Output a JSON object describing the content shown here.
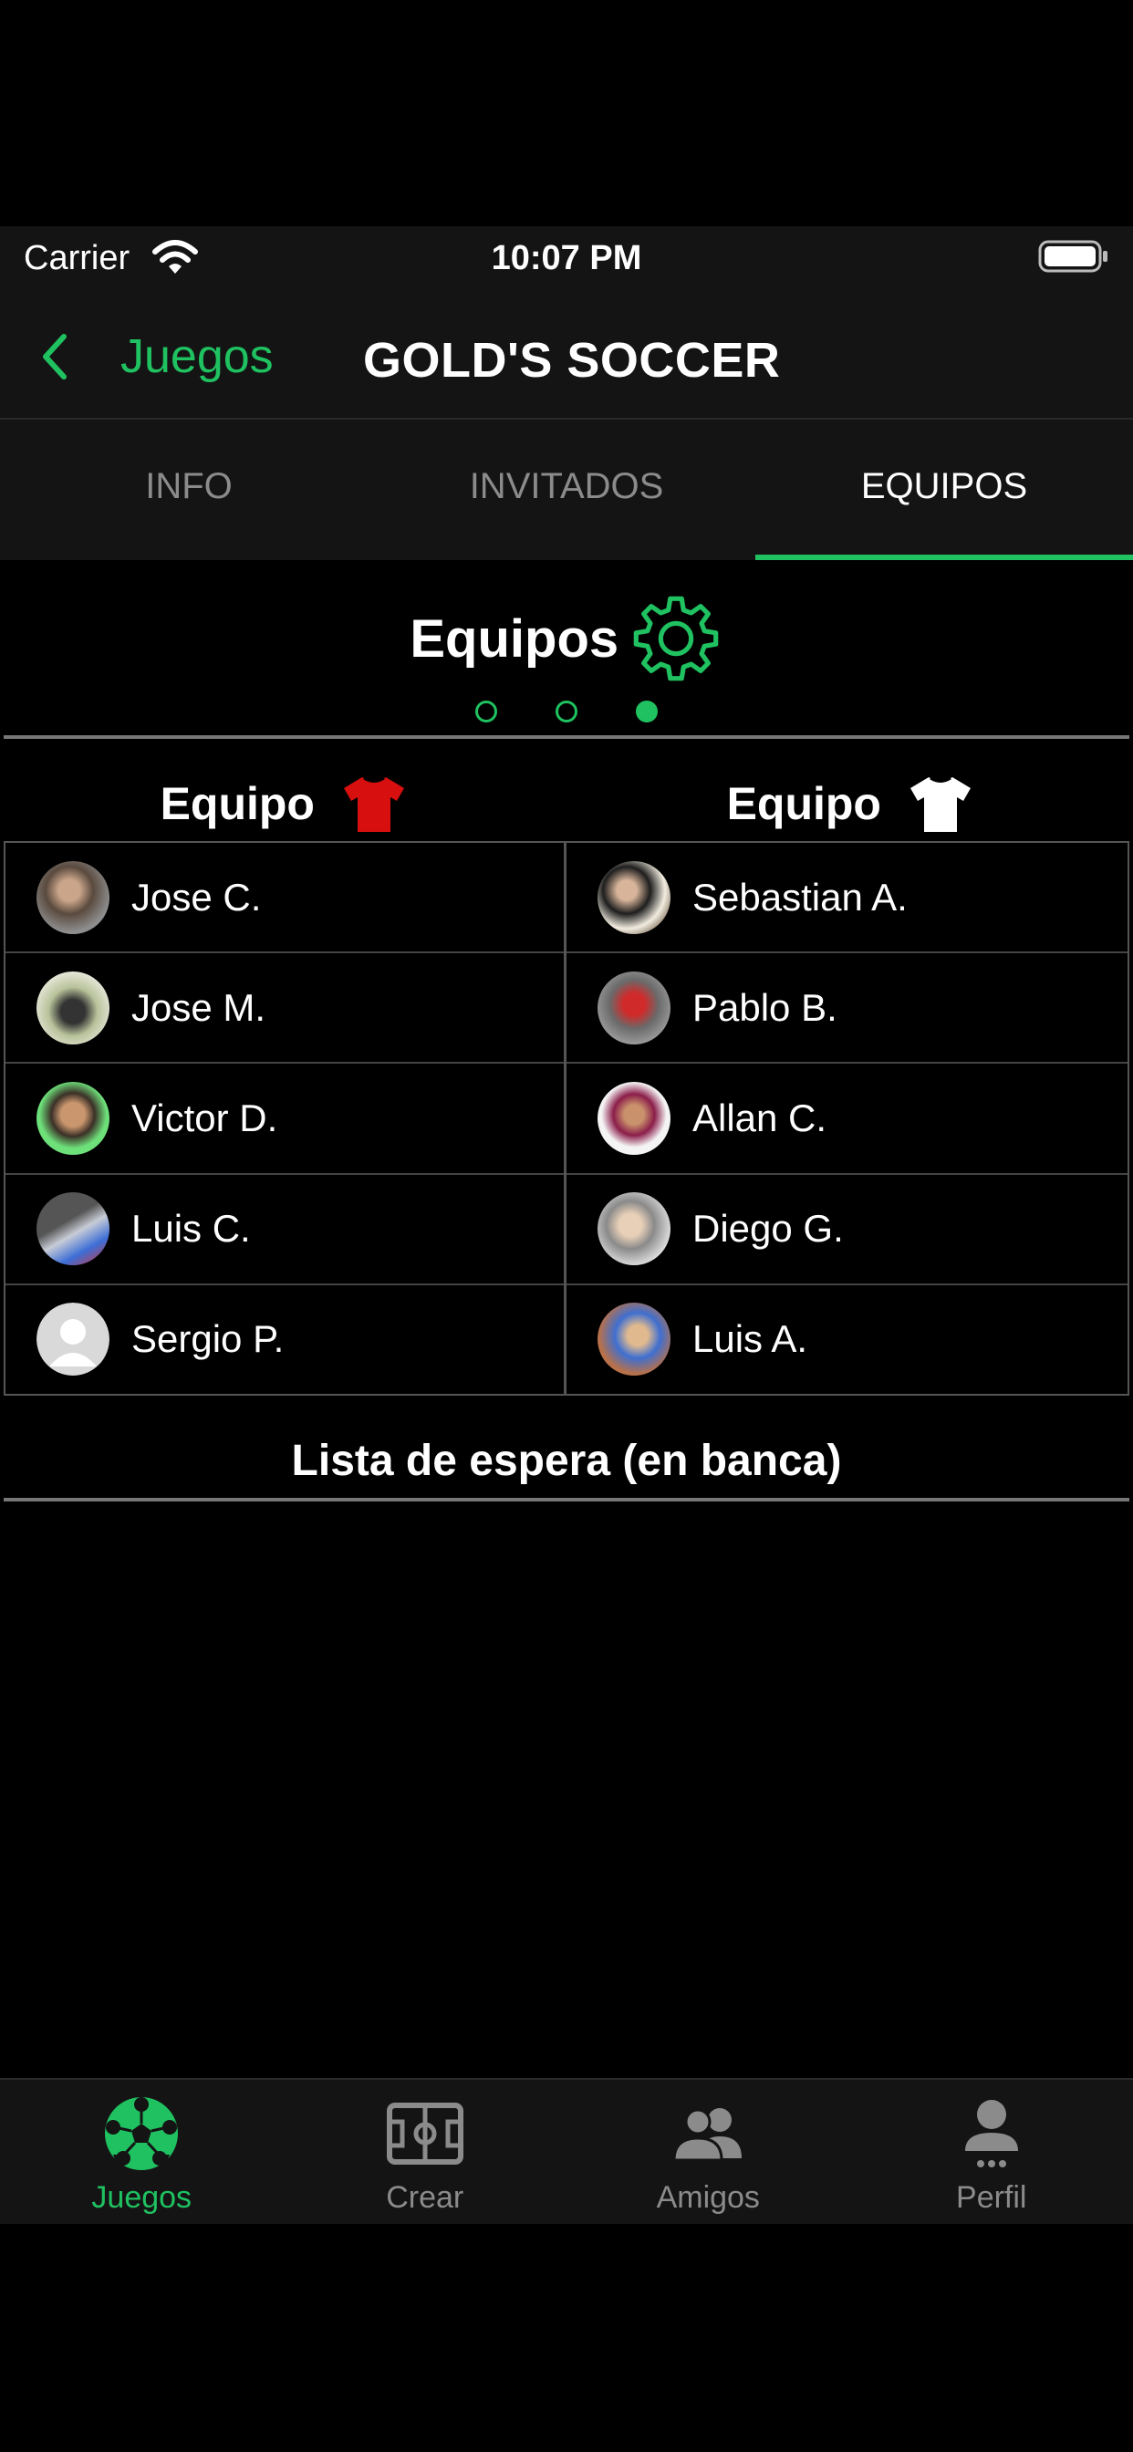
{
  "status_bar": {
    "carrier": "Carrier",
    "time": "10:07 PM"
  },
  "nav": {
    "back_label": "Juegos",
    "title": "GOLD'S SOCCER"
  },
  "tabs": [
    {
      "label": "INFO",
      "active": false
    },
    {
      "label": "INVITADOS",
      "active": false
    },
    {
      "label": "EQUIPOS",
      "active": true
    }
  ],
  "section": {
    "title": "Equipos",
    "page_indicator": {
      "count": 3,
      "current": 3
    }
  },
  "teams": {
    "left": {
      "label": "Equipo",
      "shirt_color": "#d80f0f",
      "players": [
        "Jose C.",
        "Jose M.",
        "Victor D.",
        "Luis C.",
        "Sergio P."
      ]
    },
    "right": {
      "label": "Equipo",
      "shirt_color": "#ffffff",
      "players": [
        "Sebastian A.",
        "Pablo B.",
        "Allan C.",
        "Diego G.",
        "Luis A."
      ]
    }
  },
  "bench": {
    "title": "Lista de espera (en banca)"
  },
  "tab_bar": [
    {
      "label": "Juegos",
      "icon": "soccer-ball-icon",
      "active": true
    },
    {
      "label": "Crear",
      "icon": "field-icon",
      "active": false
    },
    {
      "label": "Amigos",
      "icon": "friends-icon",
      "active": false
    },
    {
      "label": "Perfil",
      "icon": "profile-icon",
      "active": false
    }
  ],
  "colors": {
    "accent": "#1fc160",
    "bar_bg": "#141414",
    "inactive": "#8b8b8b"
  }
}
